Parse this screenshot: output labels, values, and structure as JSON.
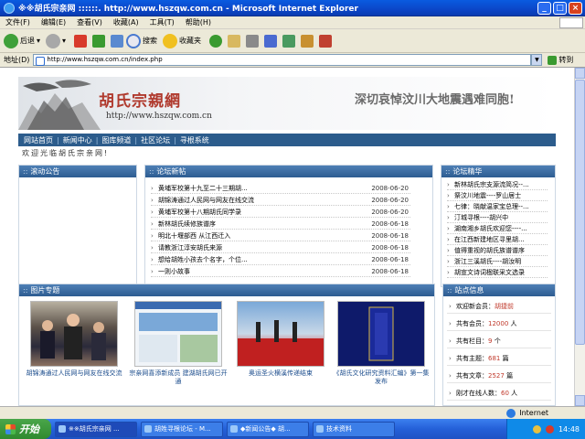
{
  "window": {
    "title": "※※胡氏宗亲网 ::::::. http://www.hszqw.com.cn - Microsoft Internet Explorer"
  },
  "menu": [
    "文件(F)",
    "编辑(E)",
    "查看(V)",
    "收藏(A)",
    "工具(T)",
    "帮助(H)"
  ],
  "toolbar": {
    "back": "后退",
    "search": "搜索",
    "favorites": "收藏夹"
  },
  "address": {
    "label": "地址(D)",
    "url": "http://www.hszqw.com.cn/index.php",
    "go": "转到"
  },
  "banner": {
    "site_name": "胡氏宗親網",
    "url": "http://www.hszqw.com.cn",
    "mourning": "深切哀悼汶川大地震遇难同胞!"
  },
  "nav": [
    "网站首页",
    "新闻中心",
    "图库频道",
    "社区论坛",
    "寻根系统"
  ],
  "welcome": "欢迎光临胡氏宗亲网!",
  "sections": {
    "news": "滚动公告",
    "forum": "论坛新帖",
    "elite": "论坛精华",
    "photos": "图片专题",
    "stats": "站点信息"
  },
  "forum_posts": [
    {
      "title": "黄埔军校第十九至二十三期胡...",
      "date": "2008-06-20"
    },
    {
      "title": "胡锦涛通过人民网与网友在线交流",
      "date": "2008-06-20"
    },
    {
      "title": "黄埔军校第十八期胡氏同学录",
      "date": "2008-06-20"
    },
    {
      "title": "新林胡氏续修族谱序",
      "date": "2008-06-18"
    },
    {
      "title": "明北十堰部西 从江西迁入",
      "date": "2008-06-18"
    },
    {
      "title": "请教浙江淳安胡氏来源",
      "date": "2008-06-18"
    },
    {
      "title": "想给胡姓小孩去个名字，个位...",
      "date": "2008-06-18"
    },
    {
      "title": "一则小故事",
      "date": "2008-06-18"
    }
  ],
  "elite_posts": [
    "新林胡氏宗支源流简况--...",
    "祭汶川地震----罗山居士",
    "七律：晓献温家宝总理--...",
    "汀城寻根----胡兴中",
    "湖南湘乡胡氏欢迎您----...",
    "在江西新建地区寻里胡...",
    "值得重视的胡氏族谱谱序",
    "浙江三溪胡氏----胡汝明",
    "胡宣文诗词楹联采文选录"
  ],
  "photos": [
    {
      "caption": "胡锦涛通过人民网与网友在线交流"
    },
    {
      "caption": "宗亲网喜添新成员 建湖胡氏网已开通"
    },
    {
      "caption": "奥运圣火横溪传递结束"
    },
    {
      "caption": "《胡氏文化研究资料汇编》第一集发布"
    }
  ],
  "stats": [
    {
      "label": "欢迎新会员：",
      "value": "胡捷前",
      "unit": ""
    },
    {
      "label": "共有会员：",
      "value": "12000",
      "unit": "人"
    },
    {
      "label": "共有栏目：",
      "value": "9",
      "unit": "个"
    },
    {
      "label": "共有主题：",
      "value": "681",
      "unit": "篇"
    },
    {
      "label": "共有文章：",
      "value": "2527",
      "unit": "篇"
    },
    {
      "label": "刚才在线人数：",
      "value": "60",
      "unit": "人"
    }
  ],
  "status": {
    "zone": "Internet"
  },
  "taskbar": {
    "start": "开始",
    "tasks": [
      "※※胡氏宗亲网 ...",
      "胡姓寻根论坛 - M...",
      "◆新闻公告◆ 胡...",
      "技术资料"
    ],
    "clock": "14:48"
  }
}
